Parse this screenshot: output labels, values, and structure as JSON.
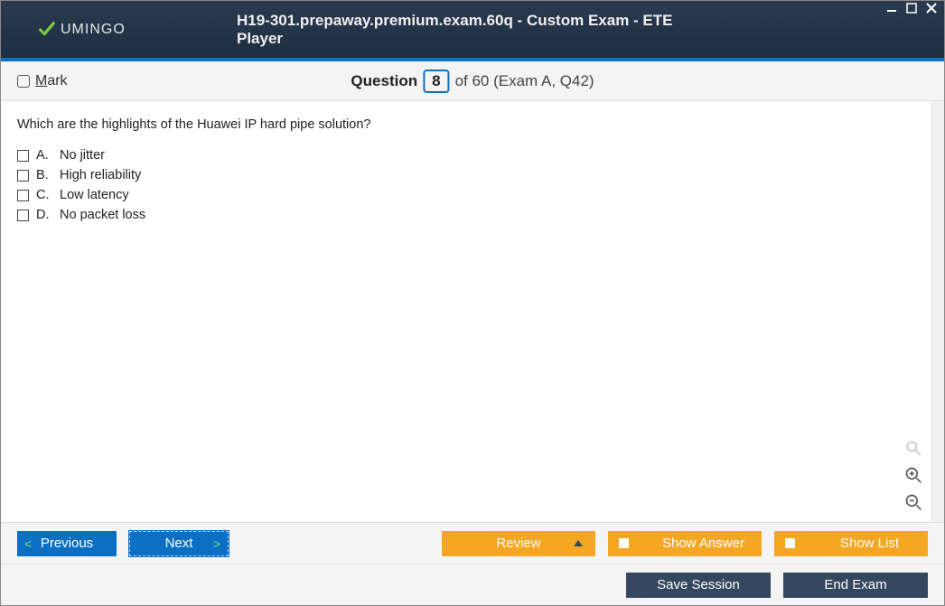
{
  "brand": "UMINGO",
  "title": "H19-301.prepaway.premium.exam.60q - Custom Exam - ETE Player",
  "mark_label_prefix": "M",
  "mark_label_rest": "ark",
  "question_word": "Question",
  "question_number": "8",
  "question_total": "of 60 (Exam A, Q42)",
  "question_text": "Which are the highlights of the Huawei IP hard pipe solution?",
  "options": [
    {
      "letter": "A.",
      "text": "No jitter"
    },
    {
      "letter": "B.",
      "text": "High reliability"
    },
    {
      "letter": "C.",
      "text": "Low latency"
    },
    {
      "letter": "D.",
      "text": "No packet loss"
    }
  ],
  "buttons": {
    "previous": "Previous",
    "next": "Next",
    "review": "Review",
    "show_answer": "Show Answer",
    "show_list": "Show List",
    "save_session": "Save Session",
    "end_exam": "End Exam"
  }
}
